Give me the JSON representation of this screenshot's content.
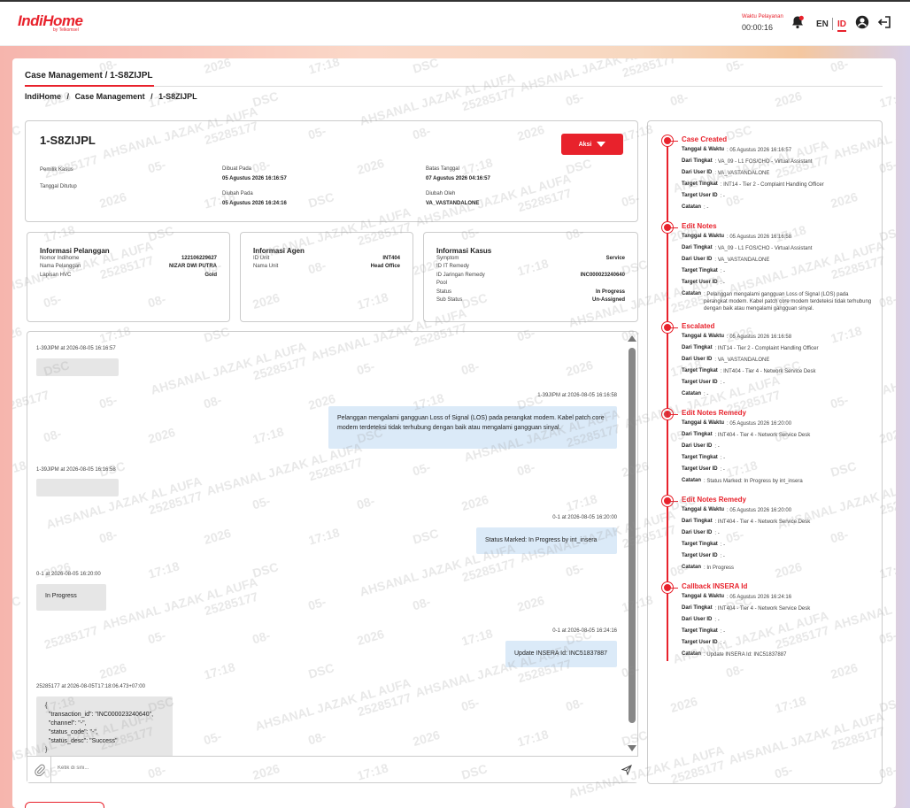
{
  "header": {
    "logo_main": "IndiHome",
    "logo_sub": "by Telkomsel",
    "timer_label": "Waktu Pelayanan",
    "timer_value": "00:00:16",
    "lang_en": "EN",
    "lang_id": "ID",
    "accent": "#e8222c"
  },
  "page": {
    "title": "Case Management / 1-S8ZIJPL",
    "breadcrumb": [
      "IndiHome",
      "/",
      "Case Management",
      "/",
      "1-S8ZIJPL"
    ]
  },
  "case": {
    "id": "1-S8ZIJPL",
    "action_label": "Aksi",
    "fields": {
      "pemilik_label": "Pemilik Kasus",
      "ditutup_label": "Tanggal Ditutup",
      "dibuat_label": "Dibuat Pada",
      "dibuat_value": "05 Agustus 2026 16:16:57",
      "diubah_label": "Diubah Pada",
      "diubah_value": "05 Agustus 2026 16:24:16",
      "batas_label": "Batas Tanggal",
      "batas_value": "07 Agustus 2026 04:16:57",
      "diubah_oleh_label": "Diubah Oleh",
      "diubah_oleh_value": "VA_VASTANDALONE"
    }
  },
  "pelanggan": {
    "title": "Informasi Pelanggan",
    "rows": [
      {
        "k": "Nomor Indihome",
        "v": "122106229627"
      },
      {
        "k": "Nama Pelanggan",
        "v": "NIZAR DWI PUTRA"
      },
      {
        "k": "Lapisan HVC",
        "v": "Gold"
      }
    ]
  },
  "agen": {
    "title": "Informasi Agen",
    "rows": [
      {
        "k": "ID Unit",
        "v": "INT404"
      },
      {
        "k": "Nama Unit",
        "v": "Head Office"
      }
    ]
  },
  "kasus": {
    "title": "Informasi Kasus",
    "rows": [
      {
        "k": "Symptom",
        "v": "Service"
      },
      {
        "k": "ID IT Remedy",
        "v": ""
      },
      {
        "k": "ID Jaringan Remedy",
        "v": "INC000023240640"
      },
      {
        "k": "Pool",
        "v": ""
      },
      {
        "k": "Status",
        "v": "In Progress"
      },
      {
        "k": "Sub Status",
        "v": "Un-Assigned"
      }
    ]
  },
  "chat": {
    "m1_meta": "1-39JIPM at 2026-08-05 16:16:57",
    "m2_meta": "1-39JIPM at 2026-08-05 16:16:58",
    "m2_text": "Pelanggan mengalami gangguan Loss of Signal (LOS) pada perangkat modem. Kabel patch core modem terdeteksi tidak terhubung dengan baik atau mengalami gangguan sinyal.",
    "m3_meta": "1-39JIPM at 2026-08-05 16:16:58",
    "m4_meta": "0-1 at 2026-08-05 16:20:00",
    "m4_text": "Status Marked: In Progress by int_insera",
    "m5_meta": "0-1 at 2026-08-05 16:20:00",
    "m5_text": "In Progress",
    "m6_meta": "0-1 at 2026-08-05 16:24:16",
    "m6_text": "Update INSERA Id: INC51837887",
    "m7_meta": "25285177 at 2026-08-05T17:18:06.473+07:00",
    "m7_text": "{\n  \"transaction_id\": \"INC000023240640\",\n  \"channel\": \"-\",\n  \"status_code\": \"-\",\n  \"status_desc\": \"Success\"\n}",
    "input_placeholder": "Ketik di sini..."
  },
  "timeline": [
    {
      "title": "Case Created",
      "rows": [
        {
          "k": "Tanggal & Waktu",
          "v": ": 05 Agustus 2026 16:16:57"
        },
        {
          "k": "Dari Tingkat",
          "v": ": VA_09 - L1 FOS/CHO - Virtual Assistant"
        },
        {
          "k": "Dari User ID",
          "v": ": VA_VASTANDALONE"
        },
        {
          "k": "Target Tingkat",
          "v": ": INT14 - Tier 2 - Complaint Handling Officer"
        },
        {
          "k": "Target User ID",
          "v": ": -"
        },
        {
          "k": "Catatan",
          "v": ": -"
        }
      ]
    },
    {
      "title": "Edit Notes",
      "rows": [
        {
          "k": "Tanggal & Waktu",
          "v": ": 05 Agustus 2026 16:16:58"
        },
        {
          "k": "Dari Tingkat",
          "v": ": VA_09 - L1 FOS/CHO - Virtual Assistant"
        },
        {
          "k": "Dari User ID",
          "v": ": VA_VASTANDALONE"
        },
        {
          "k": "Target Tingkat",
          "v": ": -"
        },
        {
          "k": "Target User ID",
          "v": ": -"
        },
        {
          "k": "Catatan",
          "v": ": Pelanggan mengalami gangguan Loss of Signal (LOS) pada perangkat modem. Kabel patch core modem terdeteksi tidak terhubung dengan baik atau mengalami gangguan sinyal."
        }
      ]
    },
    {
      "title": "Escalated",
      "rows": [
        {
          "k": "Tanggal & Waktu",
          "v": ": 05 Agustus 2026 16:16:58"
        },
        {
          "k": "Dari Tingkat",
          "v": ": INT14 - Tier 2 - Complaint Handling Officer"
        },
        {
          "k": "Dari User ID",
          "v": ": VA_VASTANDALONE"
        },
        {
          "k": "Target Tingkat",
          "v": ": INT404 - Tier 4 - Network Service Desk"
        },
        {
          "k": "Target User ID",
          "v": ": -"
        },
        {
          "k": "Catatan",
          "v": ": -"
        }
      ]
    },
    {
      "title": "Edit Notes Remedy",
      "rows": [
        {
          "k": "Tanggal & Waktu",
          "v": ": 05 Agustus 2026 16:20:00"
        },
        {
          "k": "Dari Tingkat",
          "v": ": INT404 - Tier 4 - Network Service Desk"
        },
        {
          "k": "Dari User ID",
          "v": ": -"
        },
        {
          "k": "Target Tingkat",
          "v": ": -"
        },
        {
          "k": "Target User ID",
          "v": ": -"
        },
        {
          "k": "Catatan",
          "v": ": Status Marked: In Progress by int_insera"
        }
      ]
    },
    {
      "title": "Edit Notes Remedy",
      "rows": [
        {
          "k": "Tanggal & Waktu",
          "v": ": 05 Agustus 2026 16:20:00"
        },
        {
          "k": "Dari Tingkat",
          "v": ": INT404 - Tier 4 - Network Service Desk"
        },
        {
          "k": "Dari User ID",
          "v": ": -"
        },
        {
          "k": "Target Tingkat",
          "v": ": -"
        },
        {
          "k": "Target User ID",
          "v": ": -"
        },
        {
          "k": "Catatan",
          "v": ": In Progress"
        }
      ]
    },
    {
      "title": "Callback INSERA Id",
      "rows": [
        {
          "k": "Tanggal & Waktu",
          "v": ": 05 Agustus 2026 16:24:16"
        },
        {
          "k": "Dari Tingkat",
          "v": ": INT404 - Tier 4 - Network Service Desk"
        },
        {
          "k": "Dari User ID",
          "v": ": -"
        },
        {
          "k": "Target Tingkat",
          "v": ": -"
        },
        {
          "k": "Target User ID",
          "v": ": -"
        },
        {
          "k": "Catatan",
          "v": ": Update INSERA Id: INC51837887"
        }
      ]
    }
  ],
  "watermark": {
    "tokens": [
      "05-",
      "08-",
      "2026",
      "17:18",
      "DSC",
      "AHSANAL JAZAK AL AUFA",
      "25285177"
    ]
  }
}
